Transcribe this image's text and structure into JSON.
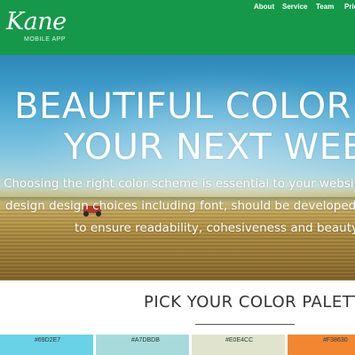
{
  "brand": {
    "name": "Kane",
    "tagline": "MOBILE APP",
    "color": "#16984A"
  },
  "nav": {
    "items": [
      {
        "label": "About"
      },
      {
        "label": "Service"
      },
      {
        "label": "Team"
      },
      {
        "label": "Pric"
      }
    ]
  },
  "hero": {
    "title_line1": "BEAUTIFUL COLOR PALET",
    "title_line2": "YOUR NEXT WEB PRO",
    "text_line1": "Choosing the right color scheme is essential to your website's suc",
    "text_line2": "design design choices including font, should be developed in conce",
    "text_line3": "to ensure readability, cohesiveness and beauty in the f"
  },
  "palette": {
    "heading": "PICK YOUR COLOR PALETTE",
    "swatches": [
      {
        "label": "#69D2E7",
        "color": "#69D2E7"
      },
      {
        "label": "#A7DBDB",
        "color": "#A7DBDB"
      },
      {
        "label": "#E0E4CC",
        "color": "#E0E4CC"
      },
      {
        "label": "#F38630",
        "color": "#F38630"
      }
    ]
  }
}
